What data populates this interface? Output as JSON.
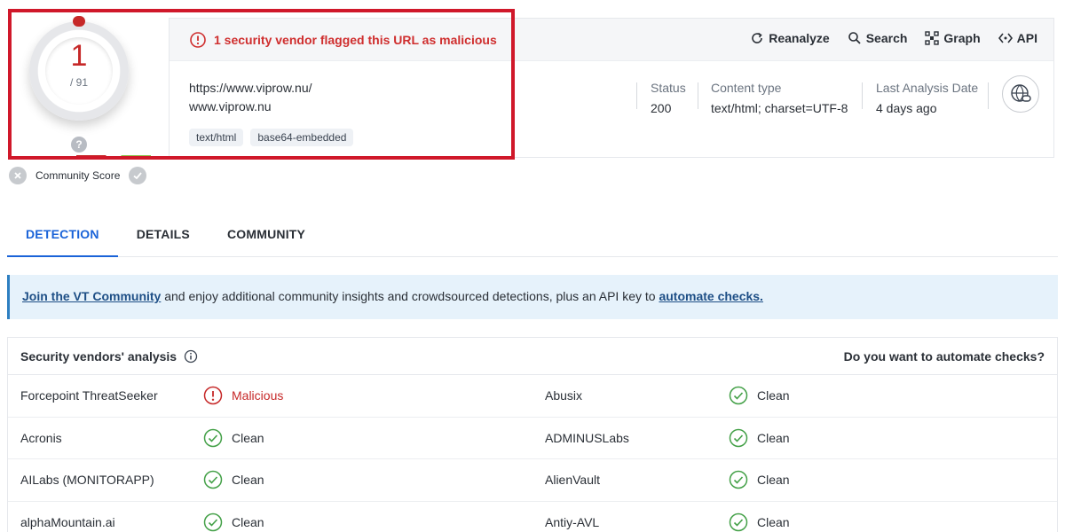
{
  "score": {
    "detections": "1",
    "total": "/ 91"
  },
  "community": {
    "label": "Community Score",
    "help": "?"
  },
  "header": {
    "flag_text": "1 security vendor flagged this URL as malicious",
    "actions": [
      {
        "label": "Reanalyze",
        "icon": "refresh-icon"
      },
      {
        "label": "Search",
        "icon": "search-icon"
      },
      {
        "label": "Graph",
        "icon": "graph-icon"
      },
      {
        "label": "API",
        "icon": "api-icon"
      }
    ],
    "url": "https://www.viprow.nu/",
    "domain": "www.viprow.nu",
    "tags": [
      "text/html",
      "base64-embedded"
    ],
    "status": {
      "label": "Status",
      "value": "200"
    },
    "content_type": {
      "label": "Content type",
      "value": "text/html; charset=UTF-8"
    },
    "last_analysis": {
      "label": "Last Analysis Date",
      "value": "4 days ago"
    }
  },
  "tabs": [
    "DETECTION",
    "DETAILS",
    "COMMUNITY"
  ],
  "banner": {
    "link1": "Join the VT Community",
    "middle": " and enjoy additional community insights and crowdsourced detections, plus an API key to ",
    "link2": "automate checks."
  },
  "vendors": {
    "title": "Security vendors' analysis",
    "automate_prompt": "Do you want to automate checks?",
    "rows": [
      {
        "left_name": "Forcepoint ThreatSeeker",
        "left_result": "Malicious",
        "right_name": "Abusix",
        "right_result": "Clean"
      },
      {
        "left_name": "Acronis",
        "left_result": "Clean",
        "right_name": "ADMINUSLabs",
        "right_result": "Clean"
      },
      {
        "left_name": "AILabs (MONITORAPP)",
        "left_result": "Clean",
        "right_name": "AlienVault",
        "right_result": "Clean"
      },
      {
        "left_name": "alphaMountain.ai",
        "left_result": "Clean",
        "right_name": "Antiy-AVL",
        "right_result": "Clean"
      }
    ]
  },
  "colors": {
    "malicious": "#c62828",
    "clean": "#43a047",
    "accent": "#1a63d8",
    "highlight": "#d0182a"
  }
}
